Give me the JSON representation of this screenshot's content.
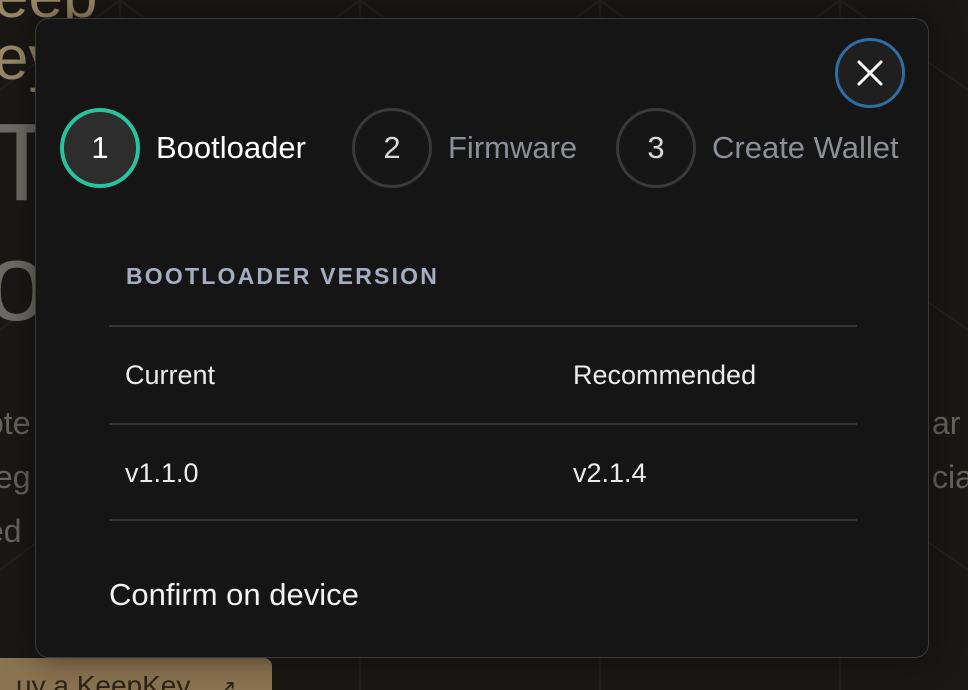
{
  "background": {
    "logo_text": "eep\ney",
    "headline_line1": "T",
    "headline_line2": "of",
    "paragraph_left": [
      "ote",
      "feg",
      "ed"
    ],
    "paragraph_right": [
      "ar",
      "cia",
      ""
    ],
    "buy_button_label": "uy a KeepKey",
    "buy_button_icon": "external-link-icon"
  },
  "modal": {
    "close_icon": "close-icon",
    "close_ring_color": "#2f6ea4",
    "steps": [
      {
        "number": "1",
        "label": "Bootloader",
        "state": "active"
      },
      {
        "number": "2",
        "label": "Firmware",
        "state": "inactive"
      },
      {
        "number": "3",
        "label": "Create Wallet",
        "state": "inactive"
      }
    ],
    "active_color": "#27c3a0",
    "section_heading": "BOOTLOADER VERSION",
    "table": {
      "headers": [
        "Current",
        "Recommended"
      ],
      "rows": [
        [
          "v1.1.0",
          "v2.1.4"
        ]
      ]
    },
    "confirm_text": "Confirm on device"
  }
}
